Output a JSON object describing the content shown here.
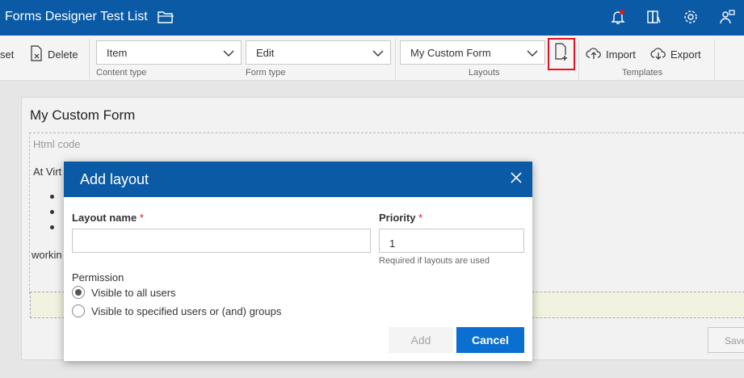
{
  "titlebar": {
    "title": "Forms Designer Test List",
    "bg": "#0b5aa6"
  },
  "toolbar": {
    "reset_label": "set",
    "delete_label": "Delete",
    "content_type": {
      "value": "Item",
      "label": "Content type"
    },
    "form_type": {
      "value": "Edit",
      "label": "Form type"
    },
    "layouts": {
      "value": "My Custom Form",
      "label": "Layouts"
    },
    "import_label": "Import",
    "export_label": "Export",
    "templates_label": "Templates",
    "highlight_color": "#e81123"
  },
  "background": {
    "form_title": "My Custom Form",
    "html_label": "Html code",
    "text_line": "At Virt",
    "text_line2": "workin",
    "save_label": "Save"
  },
  "modal": {
    "title": "Add layout",
    "layout_name_label": "Layout name",
    "layout_name_value": "",
    "priority_label": "Priority",
    "required_mark": "*",
    "priority_value": "1",
    "priority_hint": "Required if layouts are used",
    "permission_label": "Permission",
    "option_all": "Visible to all users",
    "option_specified": "Visible to specified users or (and) groups",
    "add_label": "Add",
    "cancel_label": "Cancel",
    "accent": "#0b6fd1"
  },
  "icons": [
    "folder-icon",
    "bell-icon",
    "library-icon",
    "gear-icon",
    "feedback-icon",
    "delete-doc-icon",
    "chevron-down-icon",
    "new-doc-icon",
    "cloud-upload-icon",
    "cloud-download-icon",
    "close-icon"
  ]
}
